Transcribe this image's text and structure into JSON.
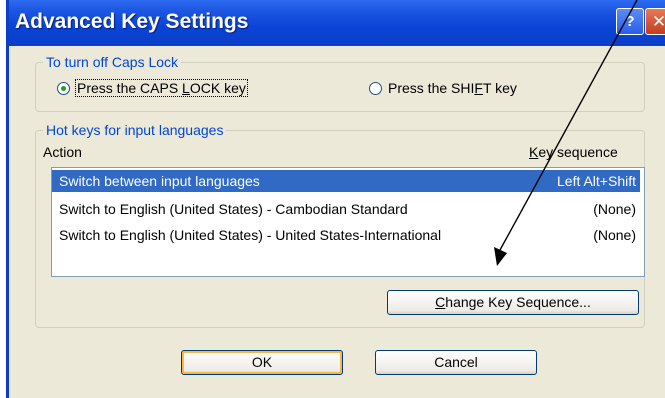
{
  "window": {
    "title": "Advanced Key Settings",
    "help_glyph": "?",
    "close_glyph": "✕"
  },
  "caps_group": {
    "legend": "To turn off Caps Lock",
    "option1": {
      "pre": "Press the CAPS ",
      "u": "L",
      "post": "OCK key",
      "checked": true
    },
    "option2": {
      "pre": "Press the SHI",
      "u": "F",
      "post": "T key",
      "checked": false
    }
  },
  "hotkeys_group": {
    "legend": "Hot keys for input languages",
    "col_action": "Action",
    "col_key": {
      "u": "K",
      "rest": "ey sequence"
    },
    "rows": [
      {
        "action": "Switch between input languages",
        "key": "Left Alt+Shift",
        "selected": true
      },
      {
        "action": "Switch to English (United States) - Cambodian Standard",
        "key": "(None)",
        "selected": false
      },
      {
        "action": "Switch to English (United States) - United States-International",
        "key": "(None)",
        "selected": false
      }
    ],
    "change_btn": {
      "u": "C",
      "rest": "hange Key Sequence..."
    }
  },
  "buttons": {
    "ok": "OK",
    "cancel": "Cancel"
  },
  "colors": {
    "title_bar": "#0a43d6",
    "selection": "#316ac5",
    "legend_text": "#0046d5"
  }
}
